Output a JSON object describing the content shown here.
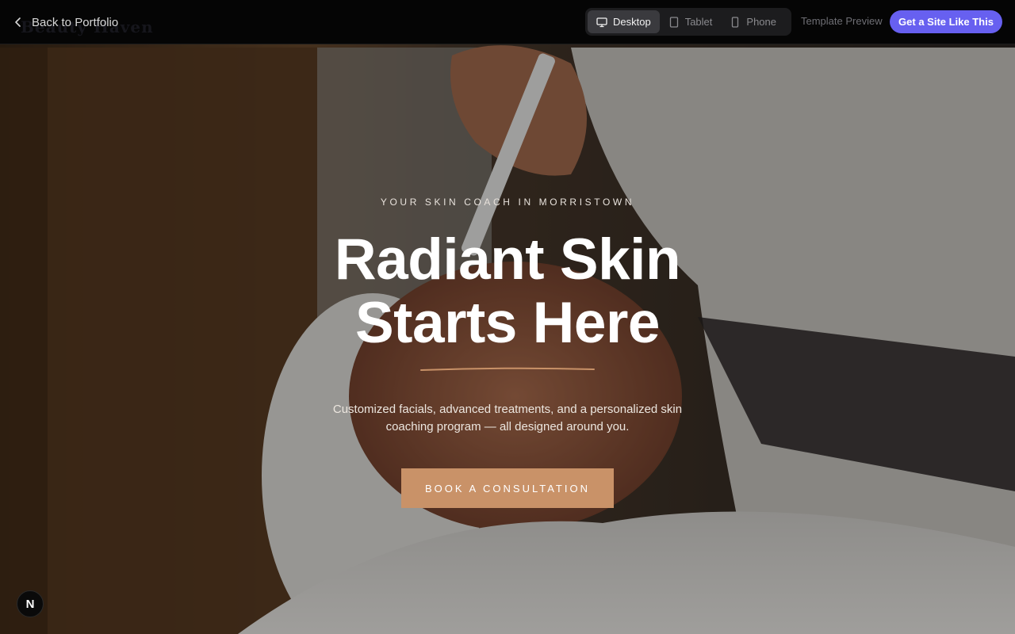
{
  "topbar": {
    "back_label": "Back to Portfolio",
    "ghost_brand": "Beauty Haven",
    "devices": [
      {
        "label": "Desktop",
        "icon": "desktop-icon",
        "active": true
      },
      {
        "label": "Tablet",
        "icon": "tablet-icon",
        "active": false
      },
      {
        "label": "Phone",
        "icon": "phone-icon",
        "active": false
      }
    ],
    "template_preview_label": "Template Preview",
    "cta_label": "Get a Site Like This"
  },
  "hero": {
    "eyebrow": "YOUR SKIN COACH IN MORRISTOWN",
    "headline_line1": "Radiant Skin",
    "headline_line2": "Starts Here",
    "subtext": "Customized facials, advanced treatments, and a personalized skin coaching program — all designed around you.",
    "button_label": "BOOK A CONSULTATION"
  },
  "badge": {
    "label": "N"
  },
  "colors": {
    "accent": "#6760f0",
    "book_button": "#c99268",
    "divider": "#c99268",
    "topbar_bg": "#050505"
  }
}
